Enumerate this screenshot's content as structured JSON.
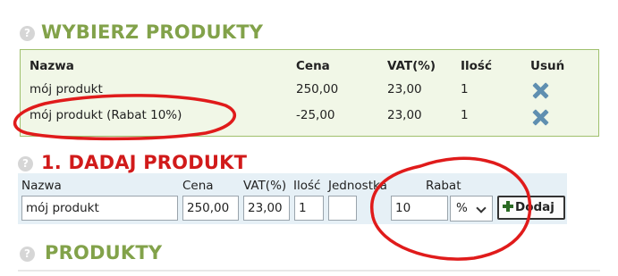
{
  "sections": {
    "selected": {
      "icon": "?",
      "title": "WYBIERZ PRODUKTY",
      "headers": {
        "name": "Nazwa",
        "price": "Cena",
        "vat": "VAT(%)",
        "qty": "Ilość",
        "remove": "Usuń"
      },
      "rows": [
        {
          "name": "mój produkt",
          "price": "250,00",
          "vat": "23,00",
          "qty": "1"
        },
        {
          "name": "mój produkt (Rabat 10%)",
          "price": "-25,00",
          "vat": "23,00",
          "qty": "1"
        }
      ]
    },
    "add": {
      "title": "1. DADAJ PRODUKT",
      "labels": {
        "name": "Nazwa",
        "price": "Cena",
        "vat": "VAT(%)",
        "qty": "Ilość",
        "unit": "Jednostka",
        "discount": "Rabat"
      },
      "values": {
        "name": "mój produkt",
        "price": "250,00",
        "vat": "23,00",
        "qty": "1",
        "unit": "",
        "discount": "10",
        "discount_type": "%"
      },
      "button_label": "Dodaj"
    },
    "products": {
      "icon": "?",
      "title": "PRODUKTY"
    }
  },
  "colors": {
    "section_title_green": "#82a24a",
    "section_title_red": "#d11a1a",
    "annotation_red": "#e01b1b",
    "delete_icon_blue": "#5f8fb0",
    "form_bar_bg": "#e6f0f6",
    "selected_box_bg": "#f1f7e7"
  },
  "icons": {
    "help": "question-circle-icon",
    "remove": "delete-x-icon",
    "add": "plus-icon",
    "select": "chevron-down-icon"
  }
}
